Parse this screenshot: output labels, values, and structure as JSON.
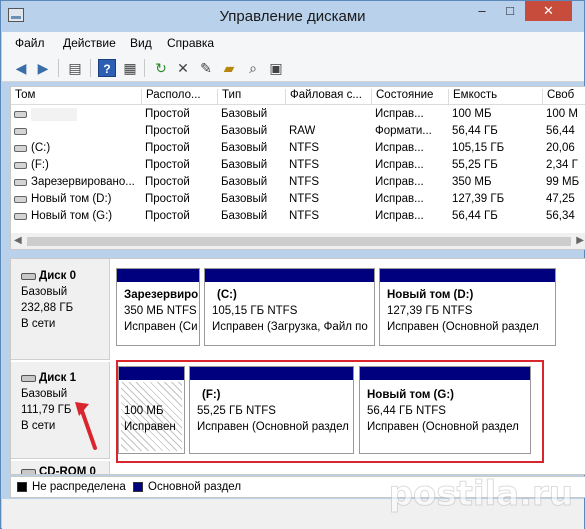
{
  "window": {
    "title": "Управление дисками"
  },
  "window_controls": {
    "min": "–",
    "max": "□",
    "close": "✕"
  },
  "menu": [
    "Файл",
    "Действие",
    "Вид",
    "Справка"
  ],
  "toolbar_icons": [
    "back-arrow-icon",
    "forward-arrow-icon",
    "properties-icon",
    "help-icon",
    "view-list-icon",
    "refresh-icon",
    "delete-icon",
    "wizard-icon",
    "folder-open-icon",
    "search-icon",
    "rescan-icon"
  ],
  "volume_table": {
    "columns": [
      "Том",
      "Располо...",
      "Тип",
      "Файловая с...",
      "Состояние",
      "Емкость",
      "Своб"
    ],
    "rows": [
      [
        "",
        "Простой",
        "Базовый",
        "",
        "Исправ...",
        "100 МБ",
        "100 М"
      ],
      [
        "",
        "Простой",
        "Базовый",
        "RAW",
        "Формати...",
        "56,44 ГБ",
        "56,44"
      ],
      [
        "(C:)",
        "Простой",
        "Базовый",
        "NTFS",
        "Исправ...",
        "105,15 ГБ",
        "20,06"
      ],
      [
        "(F:)",
        "Простой",
        "Базовый",
        "NTFS",
        "Исправ...",
        "55,25 ГБ",
        "2,34 Г"
      ],
      [
        "Зарезервировано...",
        "Простой",
        "Базовый",
        "NTFS",
        "Исправ...",
        "350 МБ",
        "99 МБ"
      ],
      [
        "Новый том (D:)",
        "Простой",
        "Базовый",
        "NTFS",
        "Исправ...",
        "127,39 ГБ",
        "47,25"
      ],
      [
        "Новый том (G:)",
        "Простой",
        "Базовый",
        "NTFS",
        "Исправ...",
        "56,44 ГБ",
        "56,34"
      ]
    ]
  },
  "disks": [
    {
      "name": "Диск 0",
      "type": "Базовый",
      "size": "232,88 ГБ",
      "status": "В сети",
      "partitions": [
        {
          "title": "Зарезервиро",
          "line1": "350 МБ NTFS",
          "line2": "Исправен (Си"
        },
        {
          "title": "(C:)",
          "line1": "105,15 ГБ NTFS",
          "line2": "Исправен (Загрузка, Файл по"
        },
        {
          "title": "Новый том  (D:)",
          "line1": "127,39 ГБ NTFS",
          "line2": "Исправен (Основной раздел"
        }
      ]
    },
    {
      "name": "Диск 1",
      "type": "Базовый",
      "size": "111,79 ГБ",
      "status": "В сети",
      "partitions": [
        {
          "title": "",
          "line1": "100 МБ",
          "line2": "Исправен"
        },
        {
          "title": "(F:)",
          "line1": "55,25 ГБ NTFS",
          "line2": "Исправен (Основной раздел"
        },
        {
          "title": "Новый том  (G:)",
          "line1": "56,44 ГБ NTFS",
          "line2": "Исправен (Основной раздел"
        }
      ]
    },
    {
      "name": "CD-ROM 0"
    }
  ],
  "legend": [
    {
      "label": "Не распределена",
      "color": "#000000"
    },
    {
      "label": "Основной раздел",
      "color": "#00007e"
    }
  ],
  "watermark": {
    "text": "postila.ru"
  }
}
